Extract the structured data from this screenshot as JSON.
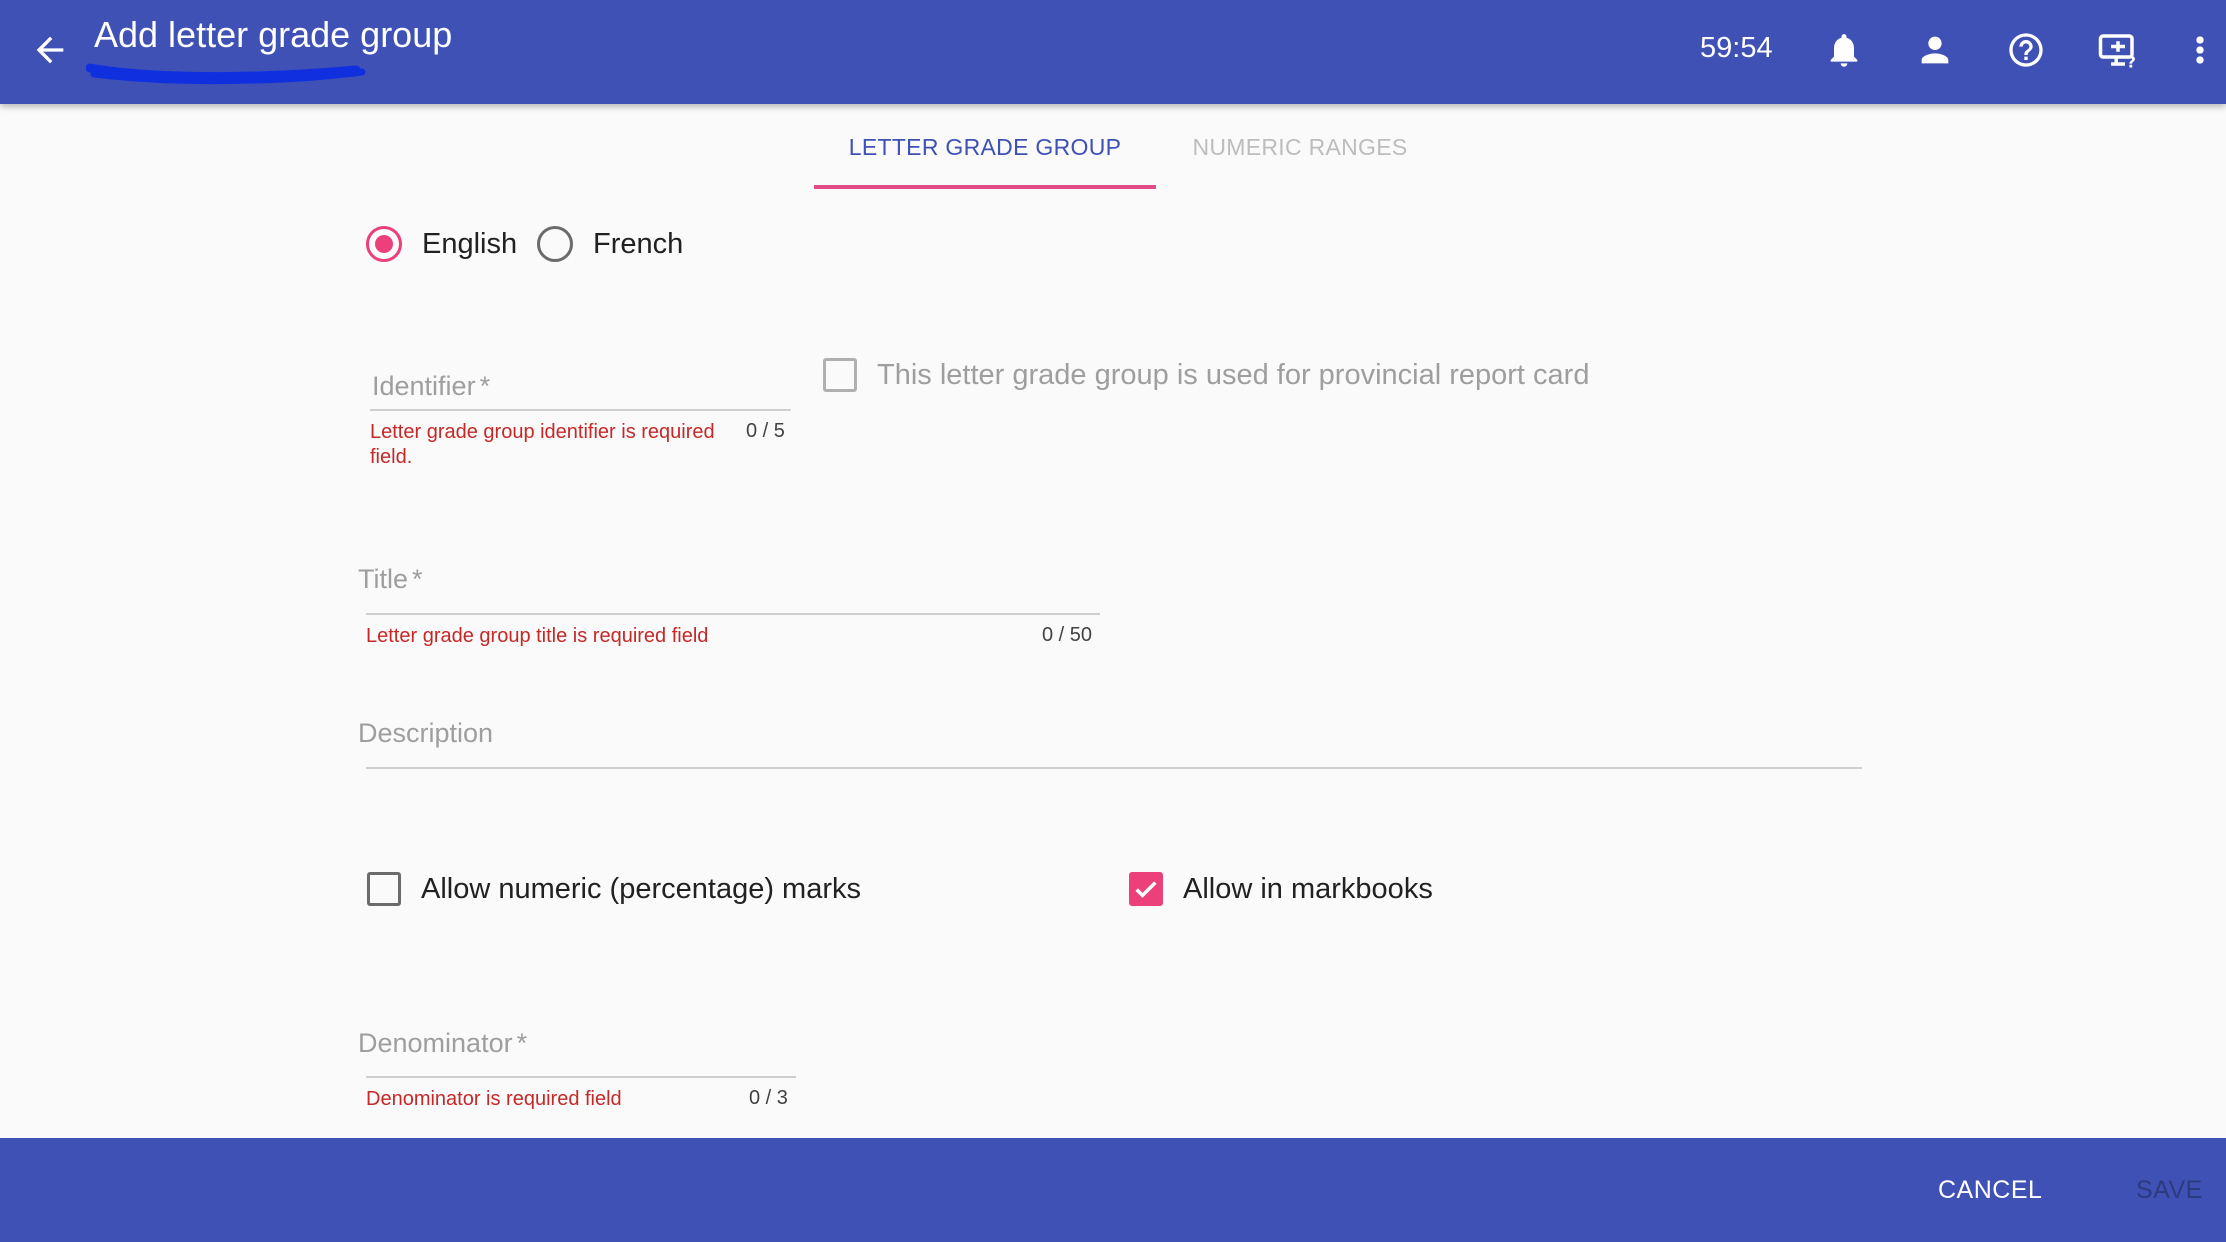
{
  "header": {
    "title": "Add letter grade group",
    "timer": "59:54",
    "icons": [
      "arrow-back-icon",
      "bell-icon",
      "person-icon",
      "help-circle-icon",
      "monitor-help-icon",
      "more-vert-icon"
    ]
  },
  "tabs": [
    {
      "label": "LETTER GRADE GROUP",
      "active": true
    },
    {
      "label": "NUMERIC RANGES",
      "active": false
    }
  ],
  "language": {
    "options": [
      "English",
      "French"
    ],
    "selected": "English"
  },
  "form": {
    "identifier": {
      "label": "Identifier",
      "required_mark": "*",
      "value": "",
      "error": "Letter grade group identifier is required field.",
      "counter": "0 / 5"
    },
    "provincial_checkbox": {
      "label": "This letter grade group is used for provincial report card",
      "checked": false,
      "disabled": true
    },
    "title": {
      "label": "Title",
      "required_mark": "*",
      "value": "",
      "error": "Letter grade group title is required field",
      "counter": "0 / 50"
    },
    "description": {
      "label": "Description",
      "value": ""
    },
    "allow_numeric": {
      "label": "Allow numeric (percentage) marks",
      "checked": false
    },
    "allow_markbooks": {
      "label": "Allow in markbooks",
      "checked": true
    },
    "denominator": {
      "label": "Denominator",
      "required_mark": "*",
      "value": "",
      "error": "Denominator is required field",
      "counter": "0 / 3"
    }
  },
  "footer": {
    "cancel_label": "CANCEL",
    "save_label": "SAVE"
  },
  "colors": {
    "primary": "#3f51b5",
    "accent": "#ec407a",
    "error": "#c62828",
    "annotation": "#1030e0"
  }
}
